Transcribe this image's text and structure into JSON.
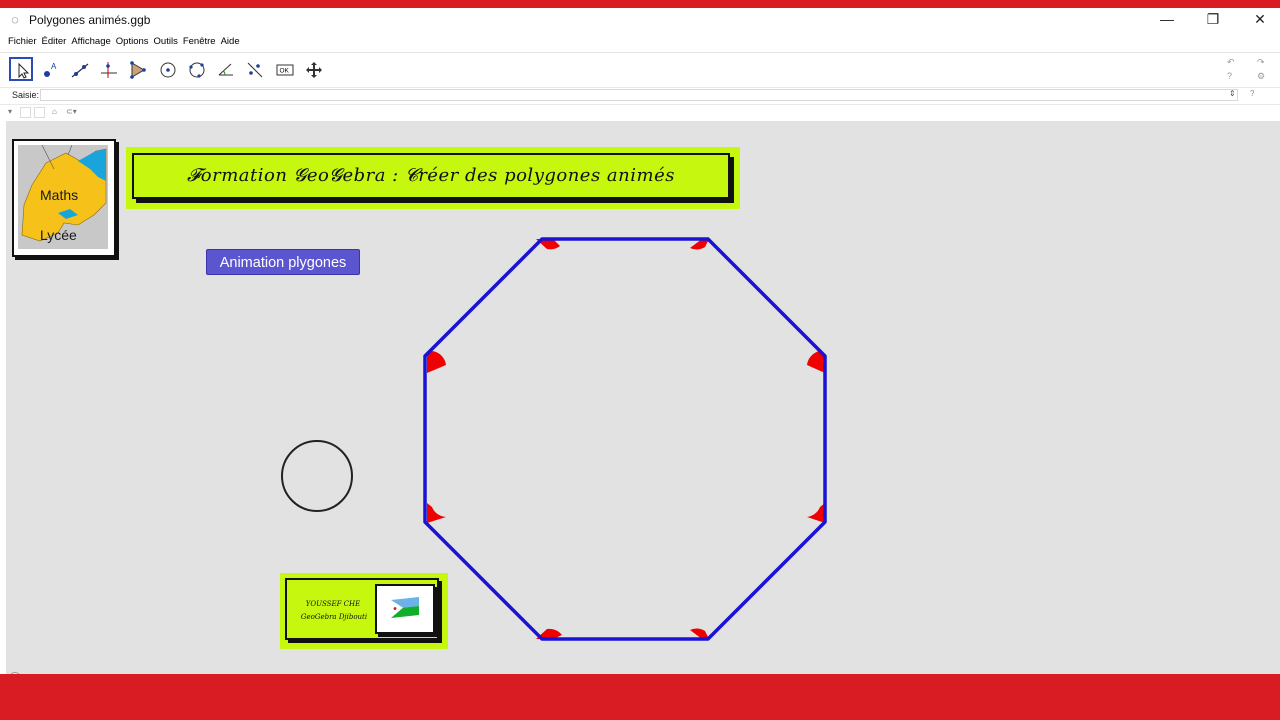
{
  "window": {
    "title": "Polygones animés.ggb",
    "app_icon": "geogebra-icon"
  },
  "window_controls": {
    "minimize": "—",
    "restore": "❐",
    "close": "✕"
  },
  "menu": [
    "Fichier",
    "Éditer",
    "Affichage",
    "Options",
    "Outils",
    "Fenêtre",
    "Aide"
  ],
  "toolbar": {
    "tools": [
      "move-tool",
      "point-tool",
      "line-tool",
      "perpendicular-tool",
      "polygon-tool",
      "circle-tool",
      "circle-three-points-tool",
      "angle-tool",
      "reflect-tool",
      "button-tool",
      "move-graphics-tool"
    ],
    "button_tool_label": "OK",
    "undo": "↶",
    "redo": "↷"
  },
  "input_bar": {
    "label": "Saisie:",
    "value": "",
    "help": "?"
  },
  "stylebar": {
    "home": "⌂"
  },
  "graphics": {
    "logo": {
      "line1": "Maths",
      "line2": "Lycée"
    },
    "banner_title": "𝓕ormation 𝓖eo𝓖ebra : 𝓒réer des polygones animés",
    "animation_button": "Animation plygones",
    "signature": {
      "name": "YOUSSEF CHE",
      "org": "GeoGebra Djibouti"
    },
    "colors": {
      "polygon_edge": "#1a12d4",
      "vertex_angle": "#f00000",
      "banner_bg": "#c6f70e",
      "button_bg": "#5b55d0"
    }
  }
}
